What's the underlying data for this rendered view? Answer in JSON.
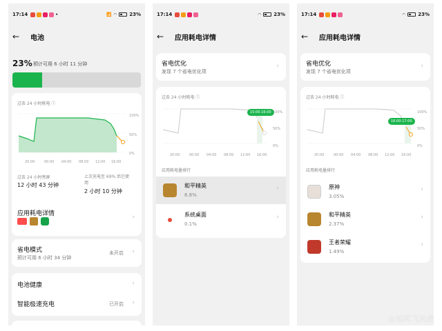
{
  "status_bar": {
    "time": "17:14",
    "battery": "23%"
  },
  "screen1": {
    "title": "电池",
    "battery_percent": "23%",
    "battery_estimate": "预计可用 6 小时 11 分钟",
    "battery_level": 0.23,
    "chart_label": "过去 24 小时耗电",
    "y_ticks": [
      "100%",
      "50%",
      "0%"
    ],
    "x_ticks": [
      "20:00",
      "00:00",
      "04:00",
      "08:00",
      "12:00",
      "16:00"
    ],
    "screen_on_label": "过去 24 小时亮屏",
    "screen_on_value": "12 小时 43 分钟",
    "last_charge_label": "上次充电至 69% 后已使用",
    "last_charge_value": "2 小时 10 分钟",
    "app_usage_label": "应用耗电详情",
    "power_save_label": "省电模式",
    "power_save_sub": "预计可用 6 小时 34 分钟",
    "power_save_state": "未开启",
    "battery_health_label": "电池健康",
    "fast_charge_label": "智能极速充电",
    "fast_charge_state": "已开启"
  },
  "screen2": {
    "title": "应用耗电详情",
    "opt_title": "省电优化",
    "opt_sub": "发现 7 个省电优化项",
    "chart_label": "过去 24 小时耗电",
    "tooltip": "15:00-16:00",
    "rank_label": "应用耗电量排行",
    "apps": [
      {
        "name": "和平精英",
        "pct": "6.8%"
      },
      {
        "name": "系统桌面",
        "pct": "0.1%"
      }
    ]
  },
  "screen3": {
    "title": "应用耗电详情",
    "opt_title": "省电优化",
    "opt_sub": "发现 7 个省电优化项",
    "chart_label": "过去 24 小时耗电",
    "tooltip": "16:00-17:00",
    "rank_label": "应用耗电量排行",
    "apps": [
      {
        "name": "原神",
        "pct": "3.05%"
      },
      {
        "name": "和平精英",
        "pct": "2.37%"
      },
      {
        "name": "王者荣耀",
        "pct": "1.49%"
      }
    ]
  },
  "watermark": "@如风飞天虎",
  "colors": {
    "accent_green": "#1bb44c",
    "orange": "#f39c12"
  }
}
